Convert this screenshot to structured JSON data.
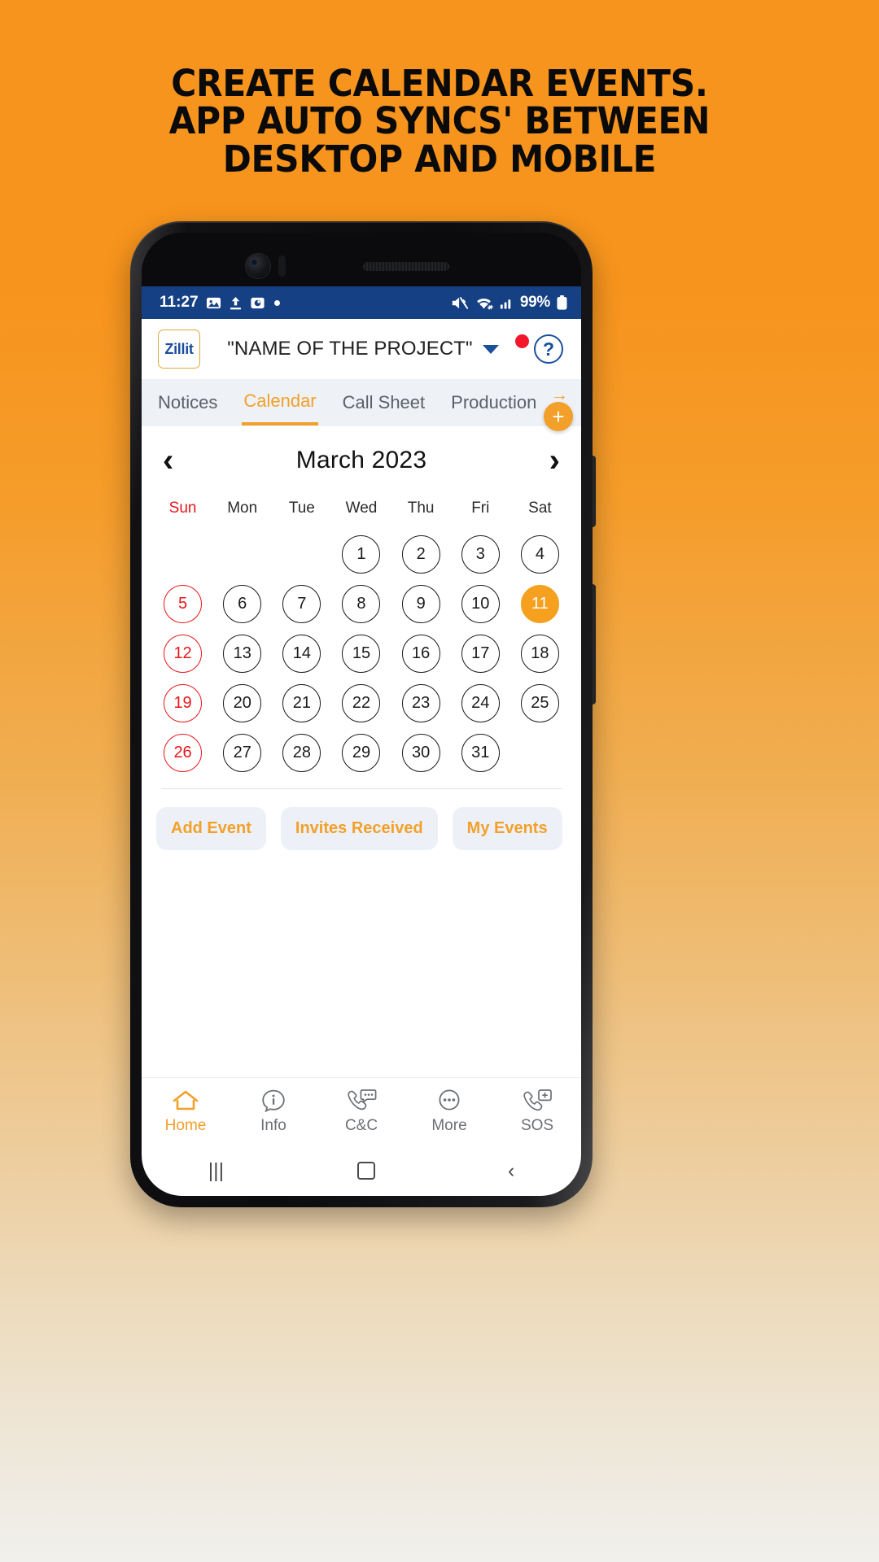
{
  "headline": {
    "line1": "CREATE CALENDAR EVENTS.",
    "line2": "APP AUTO SYNCS' BETWEEN",
    "line3": "DESKTOP AND MOBILE"
  },
  "colors": {
    "background_top": "#F7941D",
    "background_bottom": "#F1F0EC",
    "accent_orange": "#F2A02A",
    "status_bar_blue": "#154084",
    "brand_blue": "#1B4F9C",
    "sunday_red": "#E7161B",
    "notification_red": "#F4172B"
  },
  "status_bar": {
    "time": "11:27",
    "icons_left": [
      "image-icon",
      "upload-icon",
      "screenshot-icon",
      "dot-indicator"
    ],
    "icons_right": [
      "mute-icon",
      "wifi-icon",
      "signal-icon"
    ],
    "battery": "99%"
  },
  "app_header": {
    "logo_text": "Zillit",
    "project_title": "\"NAME OF THE PROJECT\"",
    "dropdown_icon": "chevron-down-icon",
    "notification_badge": true,
    "help_label": "?"
  },
  "tabs": {
    "items": [
      {
        "label": "Notices",
        "active": false
      },
      {
        "label": "Calendar",
        "active": true
      },
      {
        "label": "Call Sheet",
        "active": false
      },
      {
        "label": "Production",
        "active": false
      }
    ],
    "scroll_arrow": "→",
    "fab_label": "+"
  },
  "calendar": {
    "prev_label": "‹",
    "next_label": "›",
    "month_label": "March 2023",
    "weekdays": [
      "Sun",
      "Mon",
      "Tue",
      "Wed",
      "Thu",
      "Fri",
      "Sat"
    ],
    "selected_day": 11,
    "weeks": [
      [
        "",
        "",
        "",
        "1",
        "2",
        "3",
        "4"
      ],
      [
        "5",
        "6",
        "7",
        "8",
        "9",
        "10",
        "11"
      ],
      [
        "12",
        "13",
        "14",
        "15",
        "16",
        "17",
        "18"
      ],
      [
        "19",
        "20",
        "21",
        "22",
        "23",
        "24",
        "25"
      ],
      [
        "26",
        "27",
        "28",
        "29",
        "30",
        "31",
        ""
      ]
    ]
  },
  "actions": {
    "add_event": "Add Event",
    "invites_received": "Invites Received",
    "my_events": "My Events"
  },
  "bottom_nav": {
    "items": [
      {
        "label": "Home",
        "icon": "home-icon",
        "active": true
      },
      {
        "label": "Info",
        "icon": "info-bubble-icon",
        "active": false
      },
      {
        "label": "C&C",
        "icon": "call-chat-icon",
        "active": false
      },
      {
        "label": "More",
        "icon": "more-dots-icon",
        "active": false
      },
      {
        "label": "SOS",
        "icon": "sos-phone-icon",
        "active": false
      }
    ]
  },
  "android_nav": {
    "recents": "|||",
    "home": "home-square-icon",
    "back": "‹"
  }
}
